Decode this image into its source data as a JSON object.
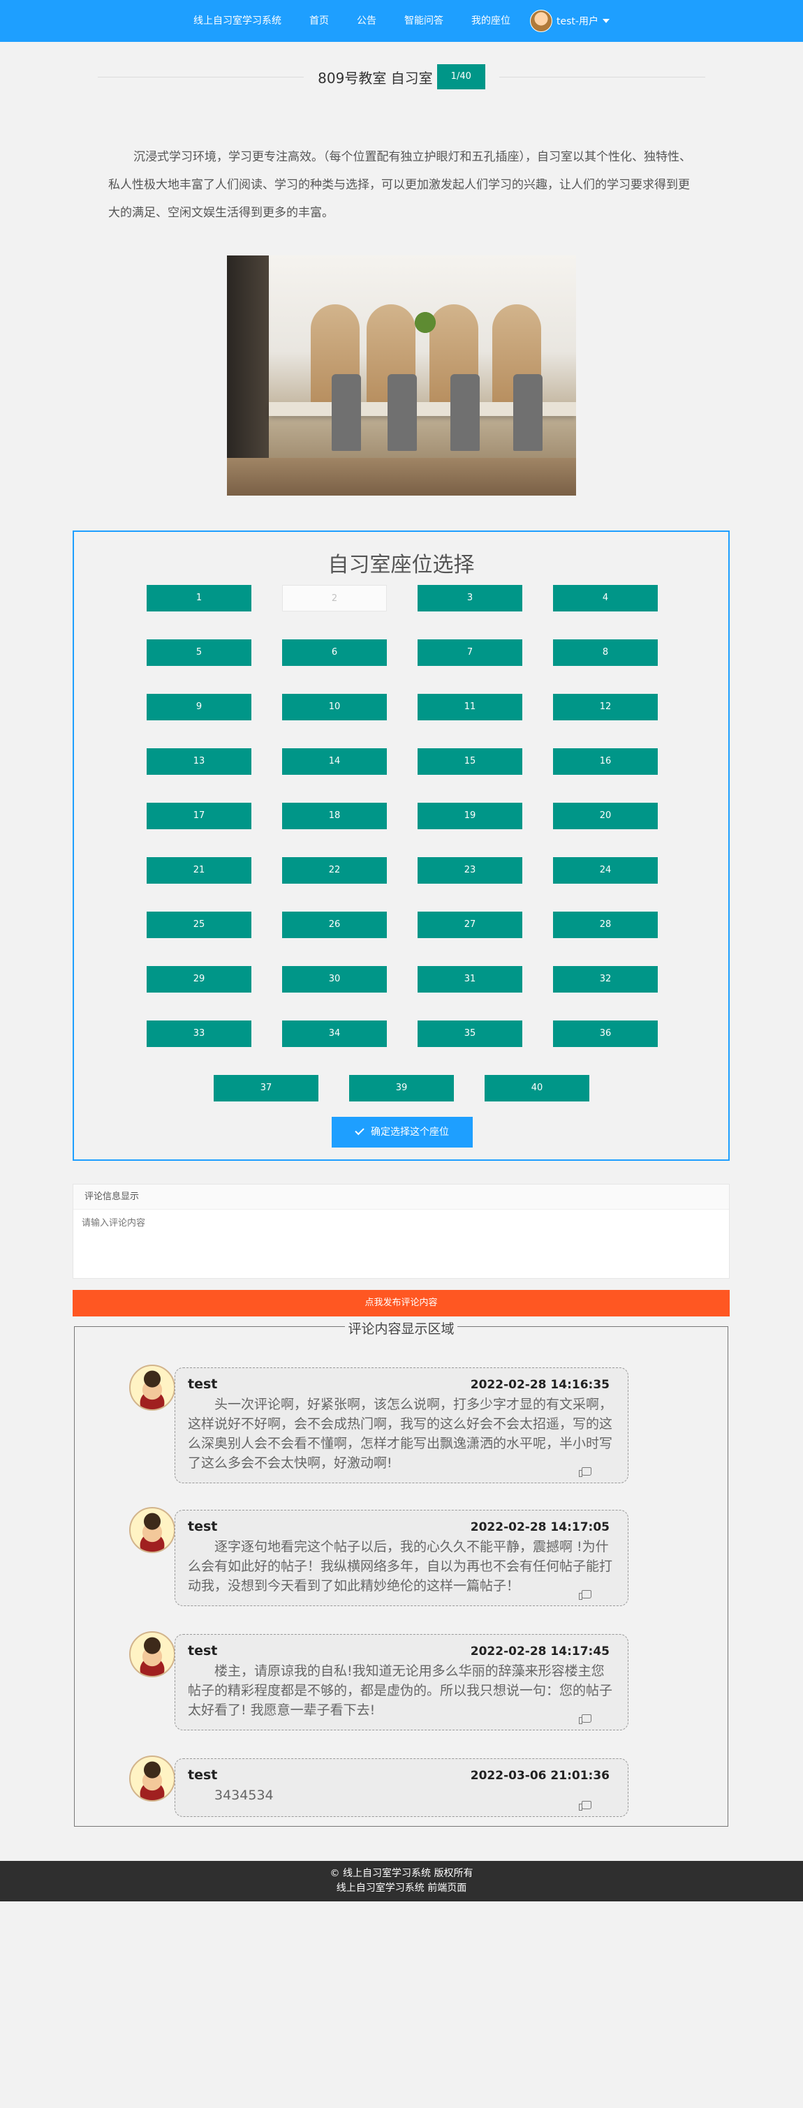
{
  "nav": {
    "brand": "线上自习室学习系统",
    "items": [
      "首页",
      "公告",
      "智能问答",
      "我的座位"
    ],
    "user": "test-用户"
  },
  "title": {
    "room": "809号教室 自习室",
    "badge": "1/40"
  },
  "intro": "沉浸式学习环境，学习更专注高效。（每个位置配有独立护眼灯和五孔插座），自习室以其个性化、独特性、私人性极大地丰富了人们阅读、学习的种类与选择，可以更加激发起人们学习的兴趣，让人们的学习要求得到更大的满足、空闲文娱生活得到更多的丰富。",
  "seat_panel": {
    "heading": "自习室座位选择",
    "seats": [
      {
        "label": "1",
        "available": true
      },
      {
        "label": "2",
        "available": false
      },
      {
        "label": "3",
        "available": true
      },
      {
        "label": "4",
        "available": true
      },
      {
        "label": "5",
        "available": true
      },
      {
        "label": "6",
        "available": true
      },
      {
        "label": "7",
        "available": true
      },
      {
        "label": "8",
        "available": true
      },
      {
        "label": "9",
        "available": true
      },
      {
        "label": "10",
        "available": true
      },
      {
        "label": "11",
        "available": true
      },
      {
        "label": "12",
        "available": true
      },
      {
        "label": "13",
        "available": true
      },
      {
        "label": "14",
        "available": true
      },
      {
        "label": "15",
        "available": true
      },
      {
        "label": "16",
        "available": true
      },
      {
        "label": "17",
        "available": true
      },
      {
        "label": "18",
        "available": true
      },
      {
        "label": "19",
        "available": true
      },
      {
        "label": "20",
        "available": true
      },
      {
        "label": "21",
        "available": true
      },
      {
        "label": "22",
        "available": true
      },
      {
        "label": "23",
        "available": true
      },
      {
        "label": "24",
        "available": true
      },
      {
        "label": "25",
        "available": true
      },
      {
        "label": "26",
        "available": true
      },
      {
        "label": "27",
        "available": true
      },
      {
        "label": "28",
        "available": true
      },
      {
        "label": "29",
        "available": true
      },
      {
        "label": "30",
        "available": true
      },
      {
        "label": "31",
        "available": true
      },
      {
        "label": "32",
        "available": true
      },
      {
        "label": "33",
        "available": true
      },
      {
        "label": "34",
        "available": true
      },
      {
        "label": "35",
        "available": true
      },
      {
        "label": "36",
        "available": true
      },
      {
        "label": "37",
        "available": true
      },
      {
        "label": "39",
        "available": true
      },
      {
        "label": "40",
        "available": true
      }
    ],
    "confirm_label": "确定选择这个座位"
  },
  "comment_form": {
    "header": "评论信息显示",
    "placeholder": "请输入评论内容",
    "submit_label": "点我发布评论内容"
  },
  "comments_section": {
    "legend": "评论内容显示区域",
    "comments": [
      {
        "user": "test",
        "time": "2022-02-28 14:16:35",
        "text": "头一次评论啊，好紧张啊，该怎么说啊，打多少字才显的有文采啊，这样说好不好啊，会不会成热门啊，我写的这么好会不会太招遥，写的这么深奥别人会不会看不懂啊，怎样才能写出飘逸潇洒的水平呢，半小时写了这么多会不会太快啊，好激动啊!"
      },
      {
        "user": "test",
        "time": "2022-02-28 14:17:05",
        "text": "逐字逐句地看完这个帖子以后，我的心久久不能平静，震撼啊 !为什么会有如此好的帖子！我纵横网络多年，自以为再也不会有任何帖子能打动我，没想到今天看到了如此精妙绝伦的这样一篇帖子！"
      },
      {
        "user": "test",
        "time": "2022-02-28 14:17:45",
        "text": "楼主，请原谅我的自私!我知道无论用多么华丽的辞藻来形容楼主您帖子的精彩程度都是不够的，都是虚伪的。所以我只想说一句：您的帖子太好看了! 我愿意一辈子看下去!"
      },
      {
        "user": "test",
        "time": "2022-03-06 21:01:36",
        "text": "3434534"
      }
    ]
  },
  "footer": {
    "line1": "© 线上自习室学习系统 版权所有",
    "line2": "线上自习室学习系统 前端页面"
  }
}
